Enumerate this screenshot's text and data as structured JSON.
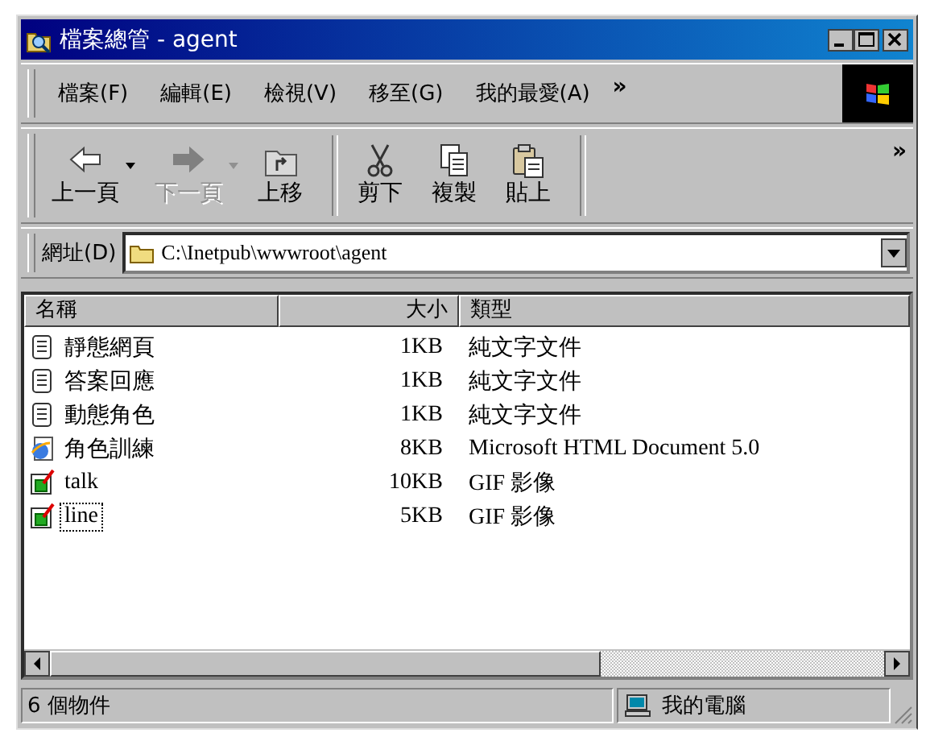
{
  "window": {
    "title": "檔案總管 - agent"
  },
  "menu": [
    "檔案(F)",
    "編輯(E)",
    "檢視(V)",
    "移至(G)",
    "我的最愛(A)"
  ],
  "menu_overflow": "»",
  "toolbar": [
    {
      "label": "上一頁",
      "kind": "back",
      "disabled": false,
      "dropdown": true
    },
    {
      "label": "下一頁",
      "kind": "forward",
      "disabled": true,
      "dropdown": true
    },
    {
      "label": "上移",
      "kind": "up",
      "disabled": false,
      "dropdown": false
    },
    {
      "label": "剪下",
      "kind": "cut",
      "disabled": false,
      "dropdown": false
    },
    {
      "label": "複製",
      "kind": "copy",
      "disabled": false,
      "dropdown": false
    },
    {
      "label": "貼上",
      "kind": "paste",
      "disabled": false,
      "dropdown": false
    }
  ],
  "toolbar_overflow": "»",
  "address": {
    "label": "網址(D)",
    "value": "C:\\Inetpub\\wwwroot\\agent"
  },
  "table": {
    "columns": [
      "名稱",
      "大小",
      "類型"
    ],
    "rows": [
      {
        "name": "靜態網頁",
        "size": "1KB",
        "type": "純文字文件",
        "kind": "text",
        "focused": false
      },
      {
        "name": "答案回應",
        "size": "1KB",
        "type": "純文字文件",
        "kind": "text",
        "focused": false
      },
      {
        "name": "動態角色",
        "size": "1KB",
        "type": "純文字文件",
        "kind": "text",
        "focused": false
      },
      {
        "name": "角色訓練",
        "size": "8KB",
        "type": "Microsoft HTML Document 5.0",
        "kind": "html",
        "focused": false
      },
      {
        "name": "talk",
        "size": "10KB",
        "type": "GIF 影像",
        "kind": "gif",
        "focused": false
      },
      {
        "name": "line",
        "size": "5KB",
        "type": "GIF 影像",
        "kind": "gif",
        "focused": true
      }
    ]
  },
  "status_bar": {
    "count": "6 個物件",
    "zone": "我的電腦"
  }
}
